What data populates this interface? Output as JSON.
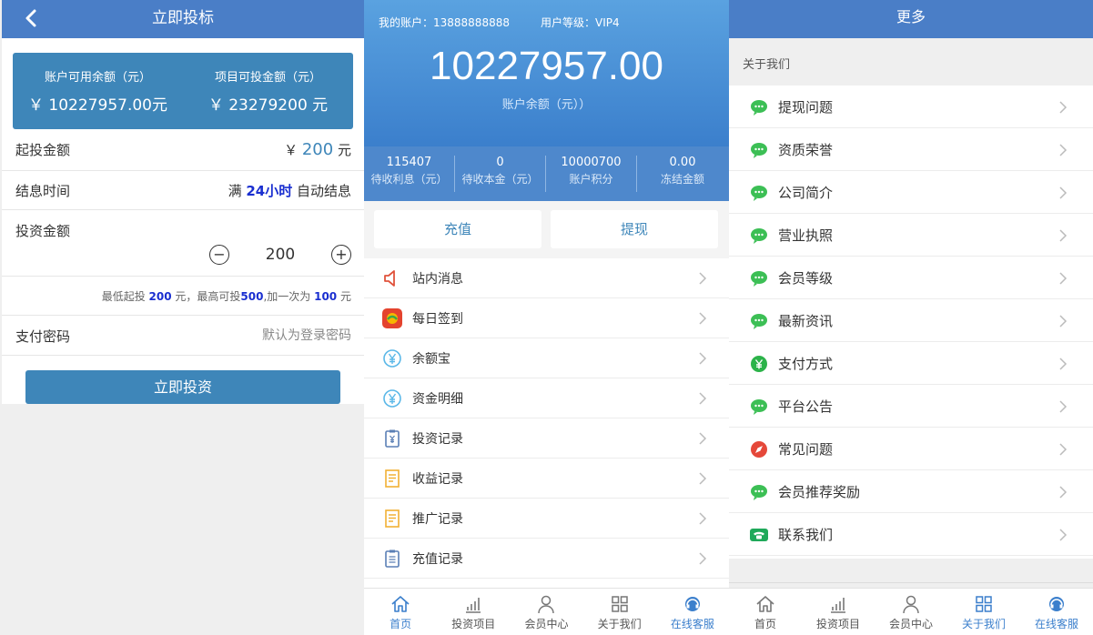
{
  "invest": {
    "title": "立即投标",
    "card": {
      "available_label": "账户可用余额（元）",
      "available_value": "￥ 10227957.00元",
      "project_label": "项目可投金额（元）",
      "project_value": "￥ 23279200 元"
    },
    "start": {
      "label": "起投金额",
      "currency": "￥ ",
      "amount": "200",
      "unit": " 元"
    },
    "settle": {
      "label": "结息时间",
      "prefix": "满 ",
      "duration": "24小时",
      "suffix": " 自动结息"
    },
    "amount": {
      "label": "投资金额",
      "value": "200",
      "minus": "−",
      "plus": "+"
    },
    "hint": {
      "t1": "最低起投 ",
      "min": "200",
      "t2": " 元，最高可投",
      "max": "500",
      "t3": ",加一次为 ",
      "step": "100",
      "t4": " 元"
    },
    "password": {
      "label": "支付密码",
      "placeholder": "默认为登录密码"
    },
    "submit": "立即投资"
  },
  "account": {
    "account_label": "我的账户：13888888888",
    "level_label": "用户等级：VIP4",
    "balance": "10227957.00",
    "balance_caption": "账户余额（元））",
    "stats": [
      {
        "num": "115407",
        "cap": "待收利息（元）"
      },
      {
        "num": "0",
        "cap": "待收本金（元）"
      },
      {
        "num": "10000700",
        "cap": "账户积分"
      },
      {
        "num": "0.00",
        "cap": "冻结金额"
      }
    ],
    "recharge": "充值",
    "withdraw": "提现",
    "menu": [
      {
        "label": "站内消息",
        "icon": "speaker-icon"
      },
      {
        "label": "每日签到",
        "icon": "checkin-icon"
      },
      {
        "label": "余额宝",
        "icon": "yen-circle-icon"
      },
      {
        "label": "资金明细",
        "icon": "yen-circle-icon"
      },
      {
        "label": "投资记录",
        "icon": "clipboard-yen-icon"
      },
      {
        "label": "收益记录",
        "icon": "note-icon"
      },
      {
        "label": "推广记录",
        "icon": "note-icon"
      },
      {
        "label": "充值记录",
        "icon": "clipboard-icon"
      }
    ],
    "colors": {
      "header_top": "#5aa2e0",
      "header_bottom": "#3b7fcc",
      "accent": "#3e86b9"
    }
  },
  "more": {
    "title": "更多",
    "section": "关于我们",
    "menu": [
      {
        "label": "提现问题",
        "icon": "chat-bubble-icon"
      },
      {
        "label": "资质荣誉",
        "icon": "chat-bubble-icon"
      },
      {
        "label": "公司简介",
        "icon": "chat-bubble-icon"
      },
      {
        "label": "营业执照",
        "icon": "chat-bubble-icon"
      },
      {
        "label": "会员等级",
        "icon": "chat-bubble-icon"
      },
      {
        "label": "最新资讯",
        "icon": "chat-bubble-icon"
      },
      {
        "label": "支付方式",
        "icon": "payment-icon"
      },
      {
        "label": "平台公告",
        "icon": "chat-bubble-icon"
      },
      {
        "label": "常见问题",
        "icon": "compass-icon"
      },
      {
        "label": "会员推荐奖励",
        "icon": "chat-bubble-icon"
      },
      {
        "label": "联系我们",
        "icon": "phone-icon"
      }
    ]
  },
  "tabbar": {
    "tabs": [
      {
        "label": "首页",
        "icon": "home-icon"
      },
      {
        "label": "投资项目",
        "icon": "bar-chart-icon"
      },
      {
        "label": "会员中心",
        "icon": "user-icon"
      },
      {
        "label": "关于我们",
        "icon": "grid-icon"
      },
      {
        "label": "在线客服",
        "icon": "headset-icon"
      }
    ],
    "account_active": "首页",
    "more_active": "关于我们"
  }
}
